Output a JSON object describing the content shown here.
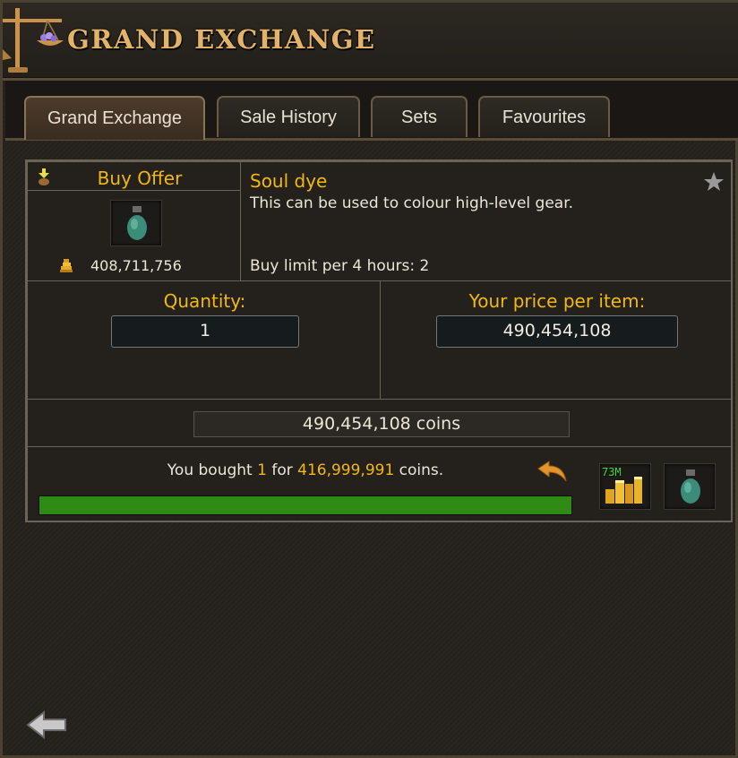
{
  "header": {
    "title": "GRAND EXCHANGE"
  },
  "tabs": [
    {
      "label": "Grand Exchange",
      "active": true
    },
    {
      "label": "Sale History",
      "active": false
    },
    {
      "label": "Sets",
      "active": false
    },
    {
      "label": "Favourites",
      "active": false
    }
  ],
  "offer": {
    "type_label": "Buy Offer",
    "guide_price": "408,711,756",
    "item_name": "Soul dye",
    "item_description": "This can be used to colour high-level gear.",
    "buy_limit": "Buy limit per 4 hours: 2",
    "quantity_label": "Quantity:",
    "quantity_value": "1",
    "price_label": "Your price per item:",
    "price_value": "490,454,108",
    "total": "490,454,108 coins",
    "status_prefix": "You bought ",
    "status_qty": "1",
    "status_mid": " for ",
    "status_amount": "416,999,991",
    "status_suffix": " coins.",
    "progress_fraction": 1.0,
    "coin_stack_count": "73M"
  },
  "colors": {
    "accent": "#f2b80e",
    "title": "#e2b368",
    "progress": "#2f8a16"
  },
  "icons": [
    "scales-icon",
    "buy-arrow-icon",
    "potion-icon",
    "coin-pile-icon",
    "star-icon",
    "undo-arrow-icon",
    "coin-stack-icon",
    "back-arrow-icon"
  ]
}
